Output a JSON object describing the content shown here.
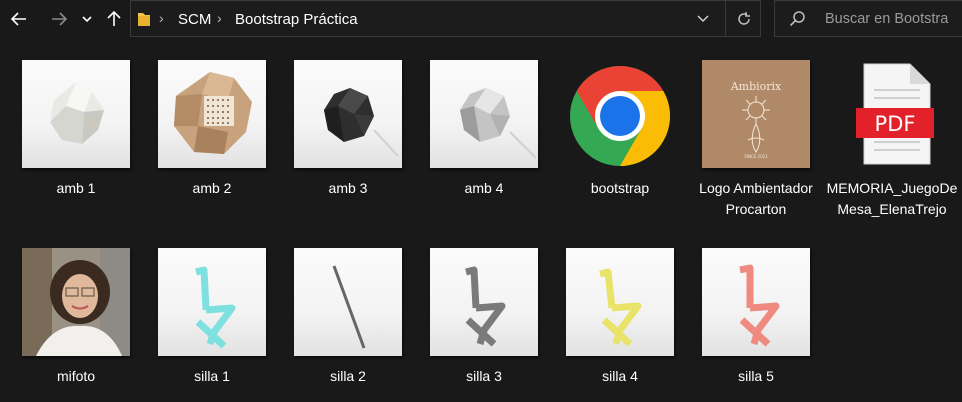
{
  "nav": {
    "back_icon": "arrow-left-icon",
    "forward_icon": "arrow-right-icon",
    "recent_icon": "chevron-down-icon",
    "up_icon": "arrow-up-icon"
  },
  "address": {
    "crumbs": [
      "SCM",
      "Bootstrap Práctica"
    ],
    "folder_color": "#f3c343"
  },
  "search": {
    "placeholder": "Buscar en Bootstrap Práctica",
    "visible_text": "Buscar en Bootstra"
  },
  "files": [
    {
      "name": "amb 1",
      "kind": "image"
    },
    {
      "name": "amb 2",
      "kind": "image"
    },
    {
      "name": "amb 3",
      "kind": "image"
    },
    {
      "name": "amb 4",
      "kind": "image"
    },
    {
      "name": "bootstrap",
      "kind": "shortcut"
    },
    {
      "name": "Logo Ambientador Procarton",
      "kind": "image"
    },
    {
      "name": "MEMORIA_JuegoDeMesa_ElenaTrejo",
      "kind": "pdf",
      "badge": "PDF"
    },
    {
      "name": "mifoto",
      "kind": "image"
    },
    {
      "name": "silla 1",
      "kind": "image",
      "color": "#7fe0e0"
    },
    {
      "name": "silla 2",
      "kind": "image",
      "color": "#666666"
    },
    {
      "name": "silla 3",
      "kind": "image",
      "color": "#7a7a7a"
    },
    {
      "name": "silla 4",
      "kind": "image",
      "color": "#e9e36a"
    },
    {
      "name": "silla 5",
      "kind": "image",
      "color": "#ef8a80"
    }
  ],
  "logo_text": {
    "top": "Ambiorix",
    "bottom": "SINCE 2021"
  }
}
